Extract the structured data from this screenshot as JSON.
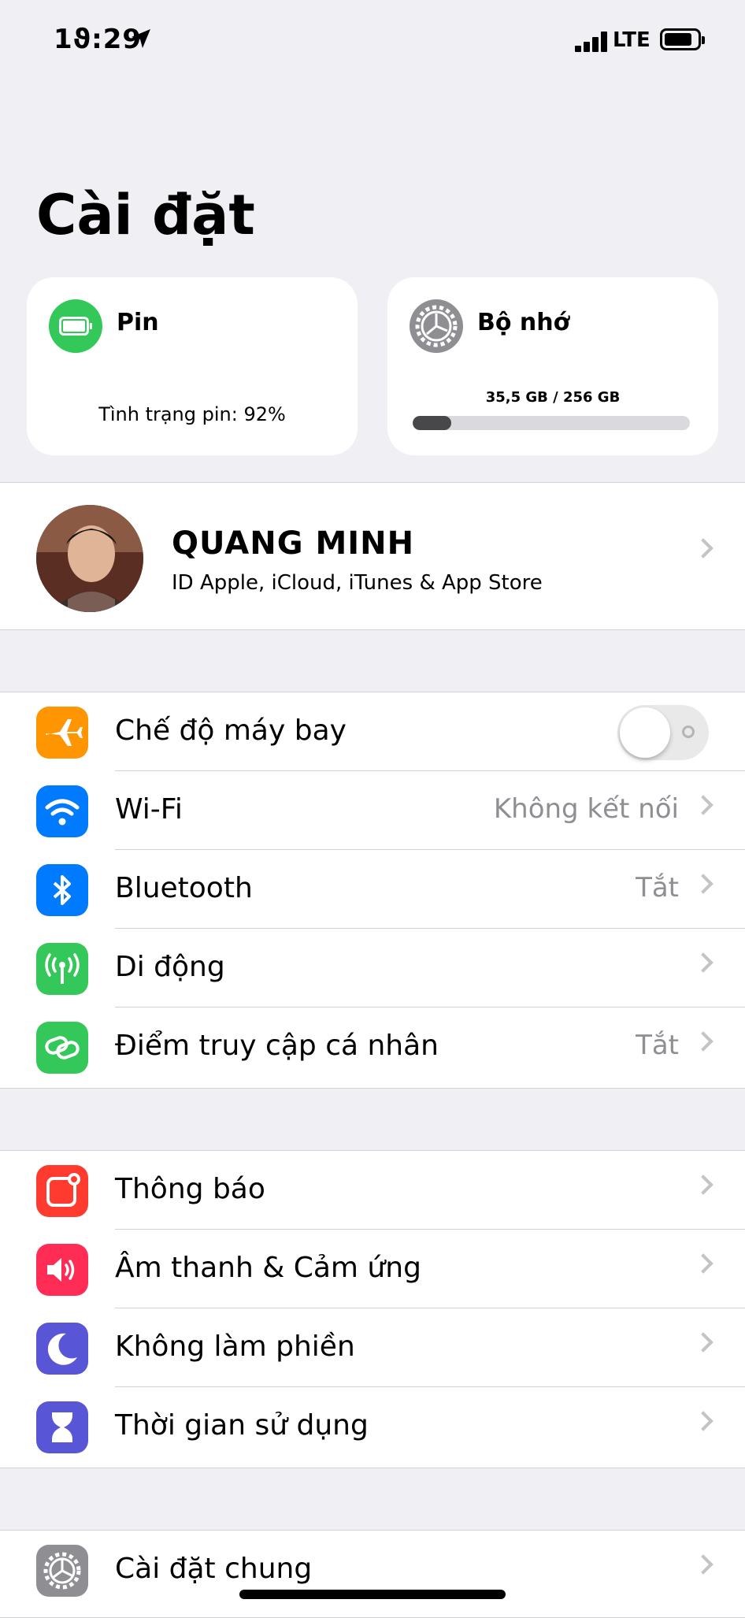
{
  "status_bar": {
    "time": "1ϑ:29",
    "network": "LTE"
  },
  "title": "Cài đặt",
  "battery_card": {
    "title": "Pin",
    "status": "Tình trạng pin: 92%"
  },
  "storage_card": {
    "title": "Bộ nhớ",
    "usage": "35,5 GB / 256 GB",
    "used_fraction": 0.14
  },
  "profile": {
    "name": "QUANG MINH",
    "subtitle": "ID Apple, iCloud, iTunes & App Store"
  },
  "group1": [
    {
      "label": "Chế độ máy bay",
      "value": "",
      "icon": "airplane-icon",
      "color": "#ff9500",
      "toggle": false
    },
    {
      "label": "Wi-Fi",
      "value": "Không kết nối",
      "icon": "wifi-icon",
      "color": "#007aff"
    },
    {
      "label": "Bluetooth",
      "value": "Tắt",
      "icon": "bluetooth-icon",
      "color": "#007aff"
    },
    {
      "label": "Di động",
      "value": "",
      "icon": "cellular-icon",
      "color": "#34c759"
    },
    {
      "label": "Điểm truy cập cá nhân",
      "value": "Tắt",
      "icon": "hotspot-icon",
      "color": "#34c759"
    }
  ],
  "group2": [
    {
      "label": "Thông báo",
      "icon": "notifications-icon",
      "color": "#ff3b30"
    },
    {
      "label": "Âm thanh & Cảm ứng",
      "icon": "sound-icon",
      "color": "#ff2d55"
    },
    {
      "label": "Không làm phiền",
      "icon": "moon-icon",
      "color": "#5856d6"
    },
    {
      "label": "Thời gian sử dụng",
      "icon": "hourglass-icon",
      "color": "#5856d6"
    }
  ],
  "group3": [
    {
      "label": "Cài đặt chung",
      "icon": "gear-icon",
      "color": "#8e8e93"
    }
  ]
}
